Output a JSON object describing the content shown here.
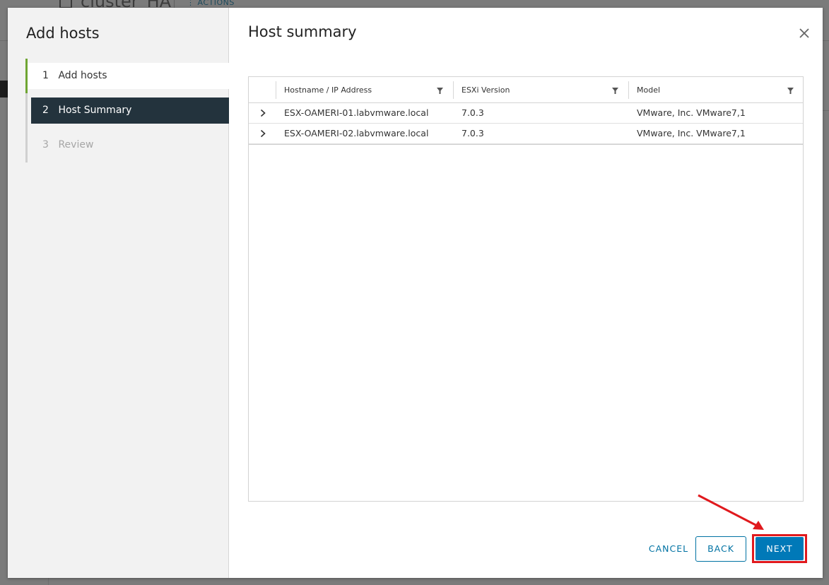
{
  "background": {
    "title": "cluster_HA",
    "actions_label": "ACTIONS"
  },
  "wizard": {
    "title": "Add hosts",
    "steps": [
      {
        "number": "1",
        "label": "Add hosts",
        "state": "done"
      },
      {
        "number": "2",
        "label": "Host Summary",
        "state": "active"
      },
      {
        "number": "3",
        "label": "Review",
        "state": "pending"
      }
    ]
  },
  "content": {
    "title": "Host summary",
    "grid": {
      "columns": [
        "Hostname / IP Address",
        "ESXi Version",
        "Model"
      ],
      "rows": [
        {
          "hostname": "ESX-OAMERI-01.labvmware.local",
          "version": "7.0.3",
          "model": "VMware, Inc. VMware7,1"
        },
        {
          "hostname": "ESX-OAMERI-02.labvmware.local",
          "version": "7.0.3",
          "model": "VMware, Inc. VMware7,1"
        }
      ]
    }
  },
  "footer": {
    "cancel_label": "CANCEL",
    "back_label": "BACK",
    "next_label": "NEXT"
  },
  "colors": {
    "active_step_bg": "#23333d",
    "done_step_accent": "#6fa533",
    "primary_button": "#0079b8",
    "highlight_annotation": "#e0191d"
  },
  "icons": {
    "close": "close-icon",
    "filter": "filter-icon",
    "expand": "chevron-right-icon",
    "annotation": "red-arrow-annotation"
  }
}
